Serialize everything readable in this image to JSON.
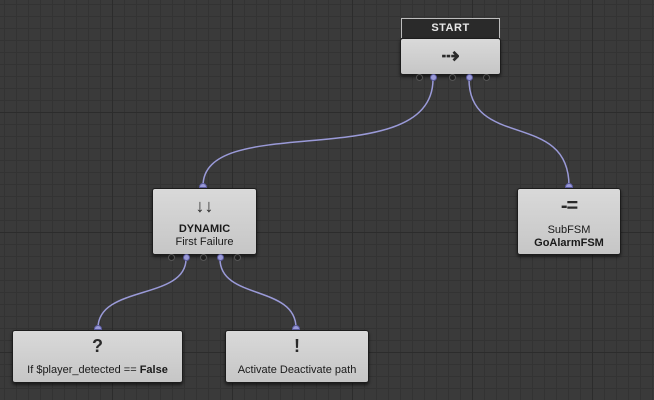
{
  "colors": {
    "wire": "#9a9ad8",
    "node_bg": "#cfcfcf",
    "canvas_bg": "#3a3a3a"
  },
  "nodes": {
    "start": {
      "tab_label": "START",
      "icon": "dynamic-arrow-icon",
      "icon_glyph": "⇢"
    },
    "dynamic": {
      "icon": "down-arrows-icon",
      "icon_glyph": "↓↓",
      "title": "DYNAMIC",
      "subtitle": "First Failure"
    },
    "subfsm": {
      "icon": "subfsm-icon",
      "icon_glyph": "-=",
      "title": "SubFSM",
      "subtitle": "GoAlarmFSM"
    },
    "condition": {
      "icon": "question-icon",
      "icon_glyph": "?",
      "label_prefix": "If $player_detected == ",
      "label_value": "False"
    },
    "action": {
      "icon": "exclamation-icon",
      "icon_glyph": "!",
      "label": "Activate Deactivate path"
    }
  }
}
